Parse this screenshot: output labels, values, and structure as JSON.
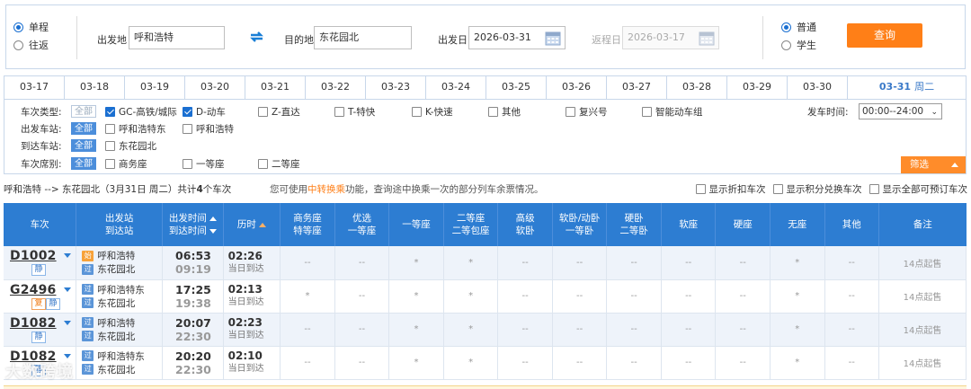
{
  "search": {
    "trip_types": [
      "单程",
      "往返"
    ],
    "from_label": "出发地",
    "from_value": "呼和浩特",
    "to_label": "目的地",
    "to_value": "东花园北",
    "depart_label": "出发日",
    "depart_value": "2026-03-31",
    "return_label": "返程日",
    "return_value": "2026-03-17",
    "passenger_types": [
      "普通",
      "学生"
    ],
    "query_button": "查询"
  },
  "date_tabs": [
    "03-17",
    "03-18",
    "03-19",
    "03-20",
    "03-21",
    "03-22",
    "03-23",
    "03-24",
    "03-25",
    "03-26",
    "03-27",
    "03-28",
    "03-29",
    "03-30"
  ],
  "active_tab": {
    "date": "03-31",
    "weekday": "周二"
  },
  "filters": {
    "train_type_label": "车次类型:",
    "all": "全部",
    "train_types": [
      "GC-高铁/城际",
      "D-动车",
      "Z-直达",
      "T-特快",
      "K-快速",
      "其他",
      "复兴号",
      "智能动车组"
    ],
    "depart_station_label": "出发车站:",
    "depart_stations": [
      "呼和浩特东",
      "呼和浩特"
    ],
    "arrive_station_label": "到达车站:",
    "arrive_stations": [
      "东花园北"
    ],
    "seat_label": "车次席别:",
    "seats": [
      "商务座",
      "一等座",
      "二等座"
    ],
    "time_label": "发车时间:",
    "time_value": "00:00--24:00",
    "filter_button": "筛选"
  },
  "summary": {
    "route": "呼和浩特 --> 东花园北（3月31日  周二）共计",
    "count": "4",
    "unit": "个车次",
    "hint_pre": "您可使用",
    "hint_link": "中转换乘",
    "hint_post": "功能，查询途中换乘一次的部分列车余票情况。",
    "options": [
      "显示折扣车次",
      "显示积分兑换车次",
      "显示全部可预订车次"
    ]
  },
  "table": {
    "headers": {
      "train": "车次",
      "station_1": "出发站",
      "station_2": "到达站",
      "time_1": "出发时间",
      "time_2": "到达时间",
      "duration": "历时",
      "business_1": "商务座",
      "business_2": "特等座",
      "premium_1": "优选",
      "premium_2": "一等座",
      "first": "一等座",
      "second_1": "二等座",
      "second_2": "二等包座",
      "softsleeper_hi_1": "高级",
      "softsleeper_hi_2": "软卧",
      "softsleeper_1": "软卧/动卧",
      "softsleeper_2": "一等卧",
      "hardsleeper_1": "硬卧",
      "hardsleeper_2": "二等卧",
      "softseat": "软座",
      "hardseat": "硬座",
      "noseat": "无座",
      "other": "其他",
      "remark": "备注"
    },
    "rows": [
      {
        "train_no": "D1002",
        "tags": [
          "静"
        ],
        "from_icon": "始",
        "from": "呼和浩特",
        "to_icon": "过",
        "to": "东花园北",
        "dep": "06:53",
        "arr": "09:19",
        "dur": "02:26",
        "dur_sub": "当日到达",
        "cells": [
          "--",
          "--",
          "*",
          "*",
          "--",
          "--",
          "--",
          "--",
          "--",
          "*",
          "--"
        ],
        "note": "14点起售"
      },
      {
        "train_no": "G2496",
        "tags": [
          "复",
          "静"
        ],
        "from_icon": "过",
        "from": "呼和浩特东",
        "to_icon": "过",
        "to": "东花园北",
        "dep": "17:25",
        "arr": "19:38",
        "dur": "02:13",
        "dur_sub": "当日到达",
        "cells": [
          "*",
          "--",
          "*",
          "*",
          "--",
          "--",
          "--",
          "--",
          "--",
          "*",
          "--"
        ],
        "note": "14点起售"
      },
      {
        "train_no": "D1082",
        "tags": [
          "静"
        ],
        "from_icon": "过",
        "from": "呼和浩特",
        "to_icon": "过",
        "to": "东花园北",
        "dep": "20:07",
        "arr": "22:30",
        "dur": "02:23",
        "dur_sub": "当日到达",
        "cells": [
          "--",
          "--",
          "*",
          "*",
          "--",
          "--",
          "--",
          "--",
          "--",
          "*",
          "--"
        ],
        "note": "14点起售"
      },
      {
        "train_no": "D1082",
        "tags": [
          "静"
        ],
        "from_icon": "过",
        "from": "呼和浩特东",
        "to_icon": "过",
        "to": "东花园北",
        "dep": "20:20",
        "arr": "22:30",
        "dur": "02:10",
        "dur_sub": "当日到达",
        "cells": [
          "--",
          "--",
          "*",
          "*",
          "--",
          "--",
          "--",
          "--",
          "--",
          "*",
          "--"
        ],
        "note": "14点起售"
      }
    ]
  },
  "watermark": "大数跨境",
  "colors": {
    "brand_blue": "#2d7dd2",
    "accent_orange": "#ff7f17",
    "row_alt": "#eef3fa"
  }
}
